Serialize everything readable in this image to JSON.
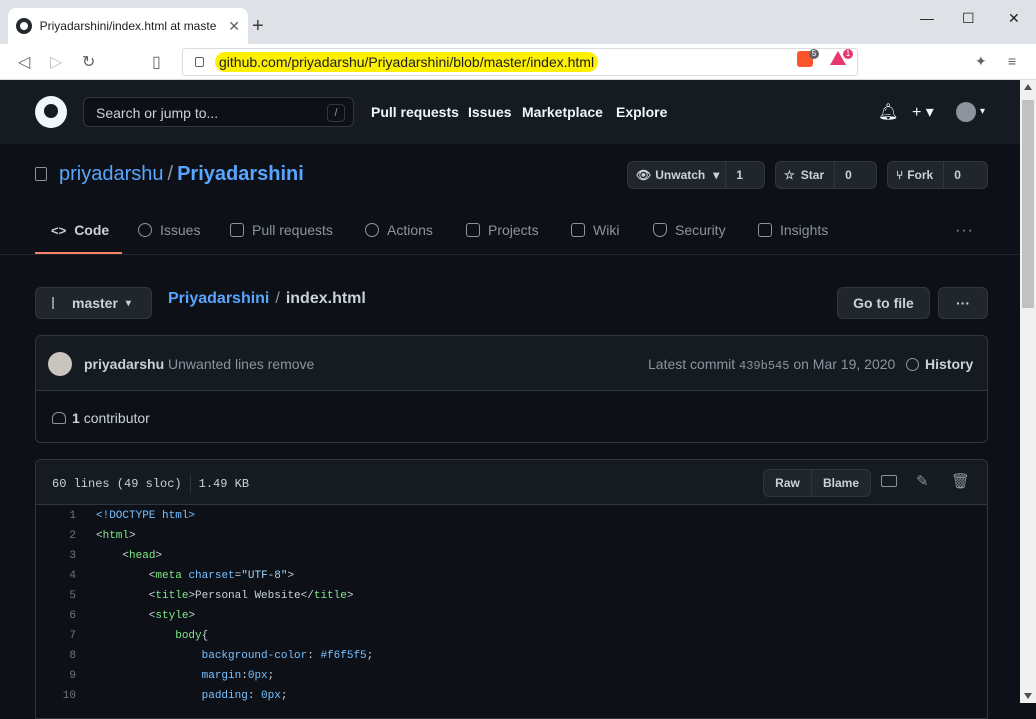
{
  "browser": {
    "tab_title": "Priyadarshini/index.html at maste",
    "new_tab": "+",
    "minimize": "—",
    "maximize": "☐",
    "close": "✕",
    "url": "github.com/priyadarshu/Priyadarshini/blob/master/index.html",
    "brave_badge_count": "5",
    "rewards_badge": "1"
  },
  "gh_header": {
    "search_placeholder": "Search or jump to...",
    "search_kbd": "/",
    "nav": [
      "Pull requests",
      "Issues",
      "Marketplace",
      "Explore"
    ]
  },
  "repo": {
    "owner": "priyadarshu",
    "separator": "/",
    "name": "Priyadarshini",
    "unwatch_label": "Unwatch",
    "unwatch_count": "1",
    "star_label": "Star",
    "star_count": "0",
    "fork_label": "Fork",
    "fork_count": "0"
  },
  "tabs": [
    {
      "label": "Code",
      "active": true
    },
    {
      "label": "Issues"
    },
    {
      "label": "Pull requests"
    },
    {
      "label": "Actions"
    },
    {
      "label": "Projects"
    },
    {
      "label": "Wiki"
    },
    {
      "label": "Security"
    },
    {
      "label": "Insights"
    }
  ],
  "file_nav": {
    "branch": "master",
    "breadcrumb_repo": "Priyadarshini",
    "breadcrumb_sep": "/",
    "breadcrumb_file": "index.html",
    "go_to_file": "Go to file",
    "more": "···"
  },
  "commit": {
    "author": "priyadarshu",
    "message": "Unwanted lines remove",
    "latest_label": "Latest commit",
    "sha": "439b545",
    "date": "on Mar 19, 2020",
    "history": "History",
    "contributors": "1",
    "contributors_label": "contributor"
  },
  "file": {
    "lines_info": "60 lines (49 sloc)",
    "size": "1.49 KB",
    "raw": "Raw",
    "blame": "Blame"
  },
  "code_lines": [
    {
      "n": "1",
      "text": "<!DOCTYPE html>"
    },
    {
      "n": "2",
      "text": "<html>"
    },
    {
      "n": "3",
      "text": "    <head>"
    },
    {
      "n": "4",
      "text": "        <meta charset=\"UTF-8\">"
    },
    {
      "n": "5",
      "text": "        <title>Personal Website</title>"
    },
    {
      "n": "6",
      "text": "        <style>"
    },
    {
      "n": "7",
      "text": "            body{"
    },
    {
      "n": "8",
      "text": "                background-color: #f6f5f5;"
    },
    {
      "n": "9",
      "text": "                margin:0px;"
    },
    {
      "n": "10",
      "text": "                padding: 0px;"
    }
  ],
  "colors": {
    "bg": "#0d1117",
    "header_bg": "#161b22",
    "link": "#58a6ff",
    "tab_underline": "#f78166",
    "url_highlight": "#fdf000"
  }
}
